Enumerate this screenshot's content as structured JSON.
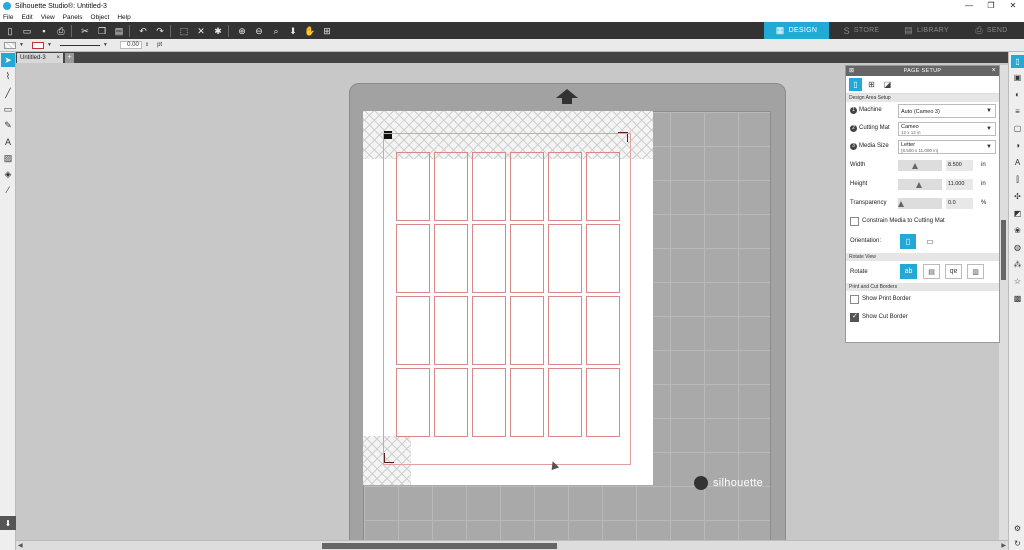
{
  "window": {
    "title": "Silhouette Studio®: Untitled-3",
    "buttons": [
      "—",
      "❐",
      "✕"
    ]
  },
  "menu": [
    "File",
    "Edit",
    "View",
    "Panels",
    "Object",
    "Help"
  ],
  "mode_tabs": [
    {
      "label": "DESIGN",
      "icon": "▦"
    },
    {
      "label": "STORE",
      "icon": "S"
    },
    {
      "label": "LIBRARY",
      "icon": "▤"
    },
    {
      "label": "SEND",
      "icon": "⎙"
    }
  ],
  "line_toolbar": {
    "line_weight": "0.00",
    "unit": "pt"
  },
  "doc_tab": {
    "name": "Untitled-3",
    "close": "×",
    "add": "+"
  },
  "canvas": {
    "brand": "silhouette"
  },
  "page_setup": {
    "title": "PAGE SETUP",
    "close": "×",
    "section_design_area": "Design Area Setup",
    "machine_label": "Machine",
    "machine_value": "Auto (Cameo 3)",
    "cutting_mat_label": "Cutting Mat",
    "cutting_mat_value": "Cameo",
    "cutting_mat_sub": "12 x 12 in",
    "media_size_label": "Media Size",
    "media_size_value": "Letter",
    "media_size_sub": "(8.500 x 11.000 in)",
    "width_label": "Width",
    "width_value": "8.500",
    "width_unit": "in",
    "height_label": "Height",
    "height_value": "11.000",
    "height_unit": "in",
    "transparency_label": "Transparency",
    "transparency_value": "0.0",
    "transparency_unit": "%",
    "constrain_label": "Constrain Media to Cutting Mat",
    "orientation_label": "Orientation:",
    "section_rotate": "Rotate View",
    "rotate_label": "Rotate",
    "section_borders": "Print and Cut Borders",
    "show_print_border": "Show Print Border",
    "show_cut_border": "Show Cut Border"
  },
  "colors": {
    "accent": "#22a9d6",
    "toolbar": "#333333",
    "cut_line": "#d88888"
  }
}
